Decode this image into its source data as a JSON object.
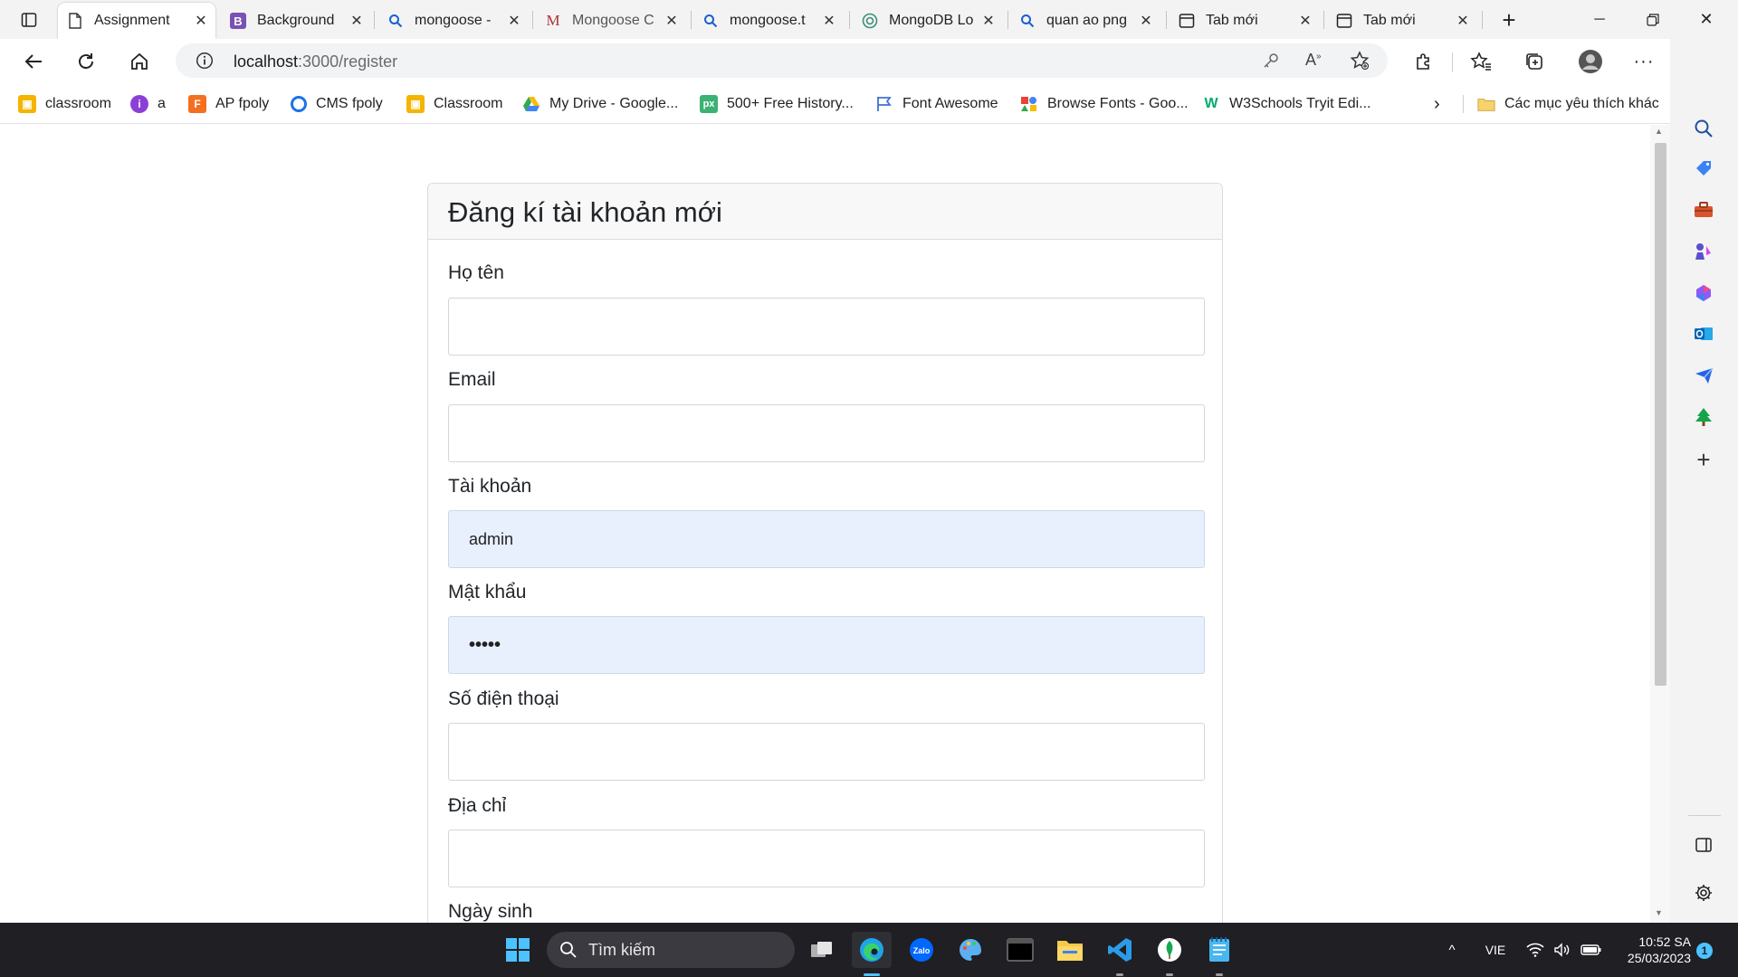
{
  "browser": {
    "tabs": [
      {
        "title": "Assignment",
        "icon": "page-icon",
        "active": true
      },
      {
        "title": "Background",
        "icon": "bootstrap-icon"
      },
      {
        "title": "mongoose -",
        "icon": "search-icon"
      },
      {
        "title": "Mongoose C",
        "icon": "medium-icon"
      },
      {
        "title": "mongoose.t",
        "icon": "search-icon"
      },
      {
        "title": "MongoDB Lo",
        "icon": "chatgpt-icon"
      },
      {
        "title": "quan ao png",
        "icon": "search-icon"
      },
      {
        "title": "Tab mới",
        "icon": "newtab-icon"
      },
      {
        "title": "Tab mới",
        "icon": "newtab-icon"
      }
    ],
    "address": {
      "host": "localhost",
      "path": ":3000/register"
    },
    "bookmarks": [
      {
        "label": "classroom",
        "icon": "classroom-icon",
        "color": "#f4b400"
      },
      {
        "label": "a",
        "icon": "purple-circle-icon",
        "color": "#8b3fd8"
      },
      {
        "label": "AP fpoly",
        "icon": "fpoly-icon",
        "color": "#f37021"
      },
      {
        "label": "CMS fpoly",
        "icon": "ring-icon",
        "color": "#1a73e8"
      },
      {
        "label": "Classroom",
        "icon": "classroom-icon",
        "color": "#f4b400"
      },
      {
        "label": "My Drive - Google...",
        "icon": "drive-icon",
        "color": "#34a853"
      },
      {
        "label": "500+ Free History...",
        "icon": "px-icon",
        "color": "#3bb273"
      },
      {
        "label": "Font Awesome",
        "icon": "flag-icon",
        "color": "#3d72d7"
      },
      {
        "label": "Browse Fonts - Goo...",
        "icon": "google-fonts-icon",
        "color": "#ea4335"
      },
      {
        "label": "W3Schools Tryit Edi...",
        "icon": "w3schools-icon",
        "color": "#04aa6d"
      }
    ],
    "other_bookmarks": "Các mục yêu thích khác"
  },
  "form": {
    "title": "Đăng kí tài khoản mới",
    "fields": [
      {
        "label": "Họ tên",
        "value": ""
      },
      {
        "label": "Email",
        "value": ""
      },
      {
        "label": "Tài khoản",
        "value": "admin"
      },
      {
        "label": "Mật khẩu",
        "value": "•••••"
      },
      {
        "label": "Số điện thoại",
        "value": ""
      },
      {
        "label": "Địa chỉ",
        "value": ""
      },
      {
        "label": "Ngày sinh",
        "value": ""
      }
    ]
  },
  "taskbar": {
    "search_placeholder": "Tìm kiếm",
    "language": "VIE",
    "time": "10:52 SA",
    "date": "25/03/2023",
    "notification_count": "1"
  },
  "colors": {
    "autofill": "#e8f0fe",
    "taskbar": "#1f1f24",
    "edge_blue": "#0f6cbd"
  }
}
